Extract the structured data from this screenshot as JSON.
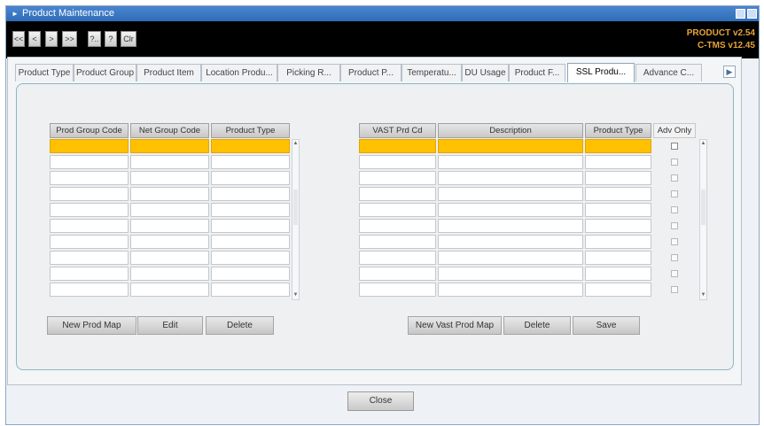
{
  "window": {
    "title": "Product Maintenance"
  },
  "toolbar": {
    "buttons": [
      "<<",
      "<",
      ">",
      ">>",
      "?..",
      "?",
      "Clr"
    ],
    "version_lines": [
      "PRODUCT v2.54",
      "C-TMS v12.45"
    ]
  },
  "tabs": [
    {
      "label": "Product Type",
      "active": false
    },
    {
      "label": "Product Group",
      "active": false
    },
    {
      "label": "Product Item",
      "active": false
    },
    {
      "label": "Location Produ...",
      "active": false
    },
    {
      "label": "Picking R...",
      "active": false
    },
    {
      "label": "Product P...",
      "active": false
    },
    {
      "label": "Temperatu...",
      "active": false
    },
    {
      "label": "DU Usage",
      "active": false
    },
    {
      "label": "Product F...",
      "active": false
    },
    {
      "label": "SSL Produ...",
      "active": true
    },
    {
      "label": "Advance C...",
      "active": false
    }
  ],
  "left_grid": {
    "columns": [
      "Prod Group Code",
      "Net Group Code",
      "Product Type"
    ],
    "rows": 10,
    "buttons": [
      "New Prod Map",
      "Edit",
      "Delete"
    ]
  },
  "right_grid": {
    "columns": [
      "VAST Prd Cd",
      "Description",
      "Product Type",
      "Adv Only"
    ],
    "rows": 10,
    "buttons": [
      "New Vast Prod Map",
      "Delete",
      "Save"
    ]
  },
  "footer": {
    "close_label": "Close"
  },
  "colors": {
    "selected_row": "#ffc000",
    "titlebar": "#3a78c2",
    "version_text": "#e6a33a"
  }
}
